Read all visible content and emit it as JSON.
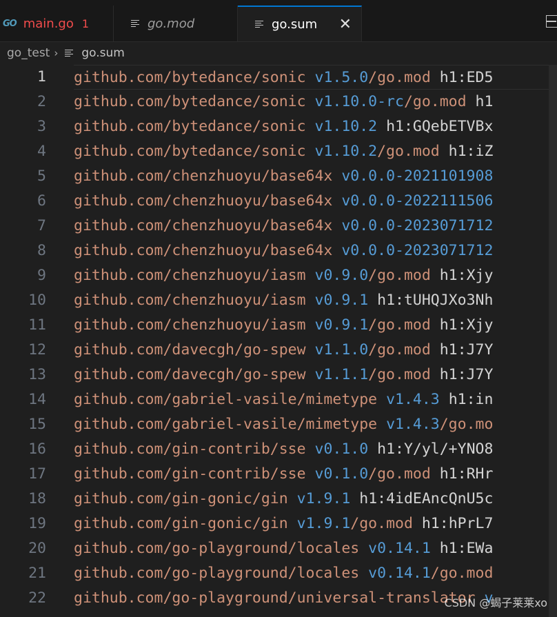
{
  "tabs": [
    {
      "icon": "go-icon",
      "label": "main.go",
      "badge": "1",
      "state": "error"
    },
    {
      "icon": "lines-icon",
      "label": "go.mod",
      "state": "preview"
    },
    {
      "icon": "lines-icon",
      "label": "go.sum",
      "state": "active"
    }
  ],
  "breadcrumb": {
    "folder": "go_test",
    "file": "go.sum"
  },
  "go_icon_text": "GO",
  "close_glyph": "✕",
  "chevron_glyph": "›",
  "lines": [
    {
      "n": "1",
      "mod": "github.com/bytedance/sonic",
      "ver": "v1.5.0",
      "ext": "/go.mod",
      "hash": "h1:ED5"
    },
    {
      "n": "2",
      "mod": "github.com/bytedance/sonic",
      "ver": "v1.10.0-rc",
      "ext": "/go.mod",
      "hash": "h1"
    },
    {
      "n": "3",
      "mod": "github.com/bytedance/sonic",
      "ver": "v1.10.2",
      "ext": "",
      "hash": "h1:GQebETVBx"
    },
    {
      "n": "4",
      "mod": "github.com/bytedance/sonic",
      "ver": "v1.10.2",
      "ext": "/go.mod",
      "hash": "h1:iZ"
    },
    {
      "n": "5",
      "mod": "github.com/chenzhuoyu/base64x",
      "ver": "v0.0.0-2021101908",
      "ext": "",
      "hash": ""
    },
    {
      "n": "6",
      "mod": "github.com/chenzhuoyu/base64x",
      "ver": "v0.0.0-2022111506",
      "ext": "",
      "hash": ""
    },
    {
      "n": "7",
      "mod": "github.com/chenzhuoyu/base64x",
      "ver": "v0.0.0-2023071712",
      "ext": "",
      "hash": ""
    },
    {
      "n": "8",
      "mod": "github.com/chenzhuoyu/base64x",
      "ver": "v0.0.0-2023071712",
      "ext": "",
      "hash": ""
    },
    {
      "n": "9",
      "mod": "github.com/chenzhuoyu/iasm",
      "ver": "v0.9.0",
      "ext": "/go.mod",
      "hash": "h1:Xjy"
    },
    {
      "n": "10",
      "mod": "github.com/chenzhuoyu/iasm",
      "ver": "v0.9.1",
      "ext": "",
      "hash": "h1:tUHQJXo3Nh"
    },
    {
      "n": "11",
      "mod": "github.com/chenzhuoyu/iasm",
      "ver": "v0.9.1",
      "ext": "/go.mod",
      "hash": "h1:Xjy"
    },
    {
      "n": "12",
      "mod": "github.com/davecgh/go-spew",
      "ver": "v1.1.0",
      "ext": "/go.mod",
      "hash": "h1:J7Y"
    },
    {
      "n": "13",
      "mod": "github.com/davecgh/go-spew",
      "ver": "v1.1.1",
      "ext": "/go.mod",
      "hash": "h1:J7Y"
    },
    {
      "n": "14",
      "mod": "github.com/gabriel-vasile/mimetype",
      "ver": "v1.4.3",
      "ext": "",
      "hash": "h1:in"
    },
    {
      "n": "15",
      "mod": "github.com/gabriel-vasile/mimetype",
      "ver": "v1.4.3",
      "ext": "/go.mo",
      "hash": ""
    },
    {
      "n": "16",
      "mod": "github.com/gin-contrib/sse",
      "ver": "v0.1.0",
      "ext": "",
      "hash": "h1:Y/yl/+YNO8"
    },
    {
      "n": "17",
      "mod": "github.com/gin-contrib/sse",
      "ver": "v0.1.0",
      "ext": "/go.mod",
      "hash": "h1:RHr"
    },
    {
      "n": "18",
      "mod": "github.com/gin-gonic/gin",
      "ver": "v1.9.1",
      "ext": "",
      "hash": "h1:4idEAncQnU5c"
    },
    {
      "n": "19",
      "mod": "github.com/gin-gonic/gin",
      "ver": "v1.9.1",
      "ext": "/go.mod",
      "hash": "h1:hPrL7"
    },
    {
      "n": "20",
      "mod": "github.com/go-playground/locales",
      "ver": "v0.14.1",
      "ext": "",
      "hash": "h1:EWa"
    },
    {
      "n": "21",
      "mod": "github.com/go-playground/locales",
      "ver": "v0.14.1",
      "ext": "/go.mod",
      "hash": ""
    },
    {
      "n": "22",
      "mod": "github.com/go-playground/universal-translator",
      "ver": "v",
      "ext": "",
      "hash": ""
    }
  ],
  "watermark": "CSDN @蝎子莱莱xo"
}
